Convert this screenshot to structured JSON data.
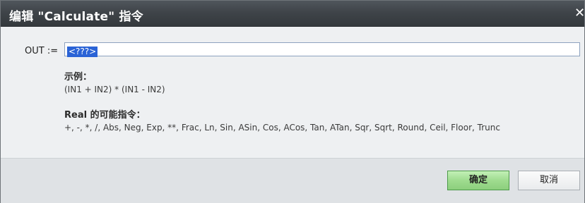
{
  "window": {
    "title": "编辑 \"Calculate\" 指令",
    "close_glyph": "✕"
  },
  "form": {
    "out_label": "OUT :=",
    "out_value": "<???>"
  },
  "help": {
    "example_heading": "示例：",
    "example_text": "(IN1 + IN2) * (IN1 - IN2)",
    "instructions_heading": "Real 的可能指令：",
    "instructions_text": "+, -, *, /, Abs, Neg, Exp, **, Frac, Ln, Sin, ASin, Cos, ACos, Tan, ATan, Sqr, Sqrt, Round, Ceil, Floor, Trunc"
  },
  "buttons": {
    "ok_label": "确定",
    "cancel_label": "取消"
  },
  "colors": {
    "titlebar": "#3f4449",
    "selection": "#2a63d6",
    "ok_button": "#9fdc8f"
  }
}
